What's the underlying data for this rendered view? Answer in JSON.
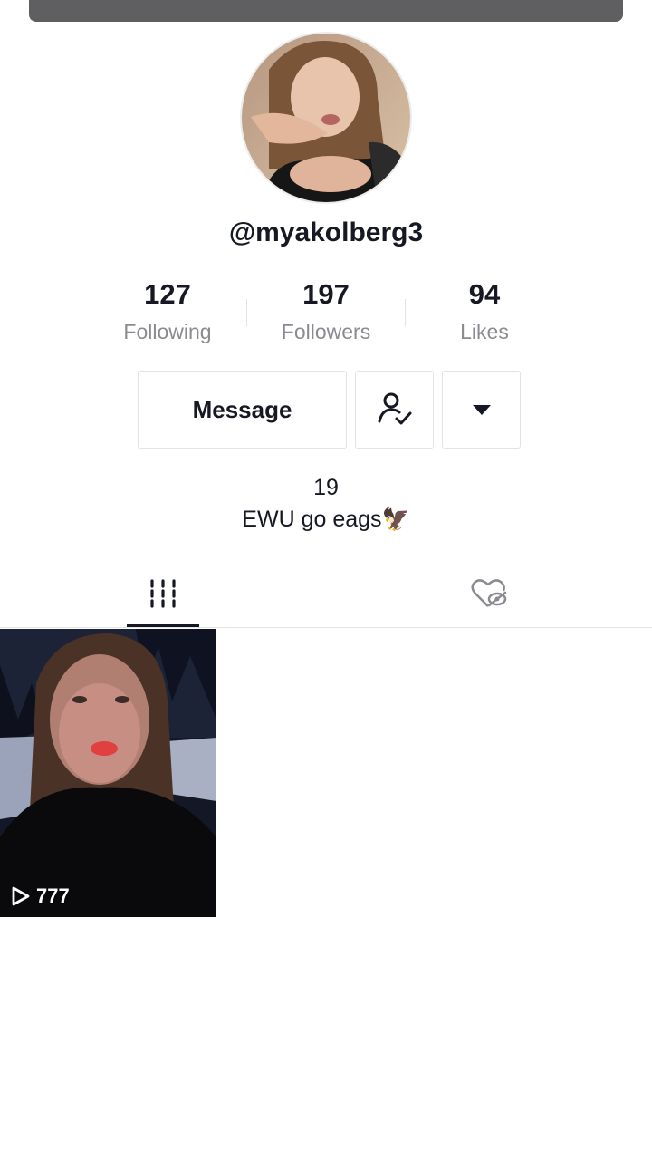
{
  "profile": {
    "username": "@myakolberg3",
    "avatar_label": "profile-photo",
    "stats": [
      {
        "value": "127",
        "label": "Following"
      },
      {
        "value": "197",
        "label": "Followers"
      },
      {
        "value": "94",
        "label": "Likes"
      }
    ],
    "bio_line1": "19",
    "bio_line2": "EWU go eags",
    "bio_emoji": "🦅"
  },
  "actions": {
    "message_label": "Message",
    "follow_icon": "user-check-icon",
    "more_icon": "caret-down-icon"
  },
  "tabs": [
    {
      "icon": "grid-icon",
      "active": true
    },
    {
      "icon": "liked-hidden-icon",
      "active": false
    }
  ],
  "videos": [
    {
      "views": "777"
    }
  ],
  "colors": {
    "text": "#161823",
    "muted": "#8a8b91",
    "border": "#e3e3e4",
    "top_bar": "#5f5f62"
  }
}
